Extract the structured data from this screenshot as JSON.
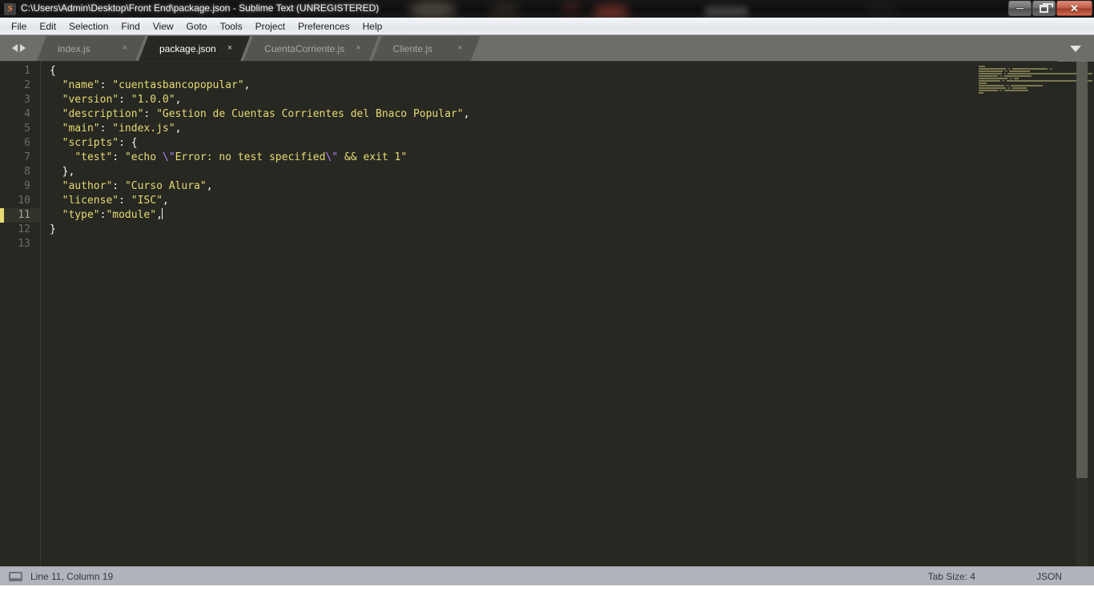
{
  "window": {
    "title": "C:\\Users\\Admin\\Desktop\\Front End\\package.json - Sublime Text (UNREGISTERED)",
    "logo_glyph": "S",
    "controls": {
      "minimize": "minimize-icon",
      "maximize": "restore-icon",
      "close": "✕"
    }
  },
  "menubar": {
    "items": [
      {
        "label": "File"
      },
      {
        "label": "Edit"
      },
      {
        "label": "Selection"
      },
      {
        "label": "Find"
      },
      {
        "label": "View"
      },
      {
        "label": "Goto"
      },
      {
        "label": "Tools"
      },
      {
        "label": "Project"
      },
      {
        "label": "Preferences"
      },
      {
        "label": "Help"
      }
    ]
  },
  "tabbar": {
    "nav_prev": "arrow-left-icon",
    "nav_next": "arrow-right-icon",
    "overflow": "chevron-down-icon",
    "close_glyph": "×",
    "tabs": [
      {
        "label": "index.js",
        "active": false
      },
      {
        "label": "package.json",
        "active": true
      },
      {
        "label": "CuentaCorriente.js",
        "active": false
      },
      {
        "label": "Cliente.js",
        "active": false
      }
    ]
  },
  "editor": {
    "active_line": 11,
    "gutter": [
      "1",
      "2",
      "3",
      "4",
      "5",
      "6",
      "7",
      "8",
      "9",
      "10",
      "11",
      "12",
      "13"
    ],
    "lines": [
      {
        "n": 1,
        "tokens": [
          {
            "t": "punc",
            "v": "{"
          }
        ]
      },
      {
        "n": 2,
        "tokens": [
          {
            "t": "punc",
            "v": "  "
          },
          {
            "t": "key",
            "v": "\"name\""
          },
          {
            "t": "punc",
            "v": ": "
          },
          {
            "t": "str",
            "v": "\"cuentasbancopopular\""
          },
          {
            "t": "punc",
            "v": ","
          }
        ]
      },
      {
        "n": 3,
        "tokens": [
          {
            "t": "punc",
            "v": "  "
          },
          {
            "t": "key",
            "v": "\"version\""
          },
          {
            "t": "punc",
            "v": ": "
          },
          {
            "t": "str",
            "v": "\"1.0.0\""
          },
          {
            "t": "punc",
            "v": ","
          }
        ]
      },
      {
        "n": 4,
        "tokens": [
          {
            "t": "punc",
            "v": "  "
          },
          {
            "t": "key",
            "v": "\"description\""
          },
          {
            "t": "punc",
            "v": ": "
          },
          {
            "t": "str",
            "v": "\"Gestion de Cuentas Corrientes del Bnaco Popular\""
          },
          {
            "t": "punc",
            "v": ","
          }
        ]
      },
      {
        "n": 5,
        "tokens": [
          {
            "t": "punc",
            "v": "  "
          },
          {
            "t": "key",
            "v": "\"main\""
          },
          {
            "t": "punc",
            "v": ": "
          },
          {
            "t": "str",
            "v": "\"index.js\""
          },
          {
            "t": "punc",
            "v": ","
          }
        ]
      },
      {
        "n": 6,
        "tokens": [
          {
            "t": "punc",
            "v": "  "
          },
          {
            "t": "key",
            "v": "\"scripts\""
          },
          {
            "t": "punc",
            "v": ": {"
          }
        ]
      },
      {
        "n": 7,
        "tokens": [
          {
            "t": "punc",
            "v": "    "
          },
          {
            "t": "key",
            "v": "\"test\""
          },
          {
            "t": "punc",
            "v": ": "
          },
          {
            "t": "str",
            "v": "\"echo "
          },
          {
            "t": "esc",
            "v": "\\\""
          },
          {
            "t": "str",
            "v": "Error: no test specified"
          },
          {
            "t": "esc",
            "v": "\\\""
          },
          {
            "t": "str",
            "v": " && exit 1\""
          }
        ]
      },
      {
        "n": 8,
        "tokens": [
          {
            "t": "punc",
            "v": "  },"
          }
        ]
      },
      {
        "n": 9,
        "tokens": [
          {
            "t": "punc",
            "v": "  "
          },
          {
            "t": "key",
            "v": "\"author\""
          },
          {
            "t": "punc",
            "v": ": "
          },
          {
            "t": "str",
            "v": "\"Curso Alura\""
          },
          {
            "t": "punc",
            "v": ","
          }
        ]
      },
      {
        "n": 10,
        "tokens": [
          {
            "t": "punc",
            "v": "  "
          },
          {
            "t": "key",
            "v": "\"license\""
          },
          {
            "t": "punc",
            "v": ": "
          },
          {
            "t": "str",
            "v": "\"ISC\""
          },
          {
            "t": "punc",
            "v": ","
          }
        ]
      },
      {
        "n": 11,
        "tokens": [
          {
            "t": "punc",
            "v": "  "
          },
          {
            "t": "key",
            "v": "\"type\""
          },
          {
            "t": "punc",
            "v": ":"
          },
          {
            "t": "str",
            "v": "\"module\""
          },
          {
            "t": "punc",
            "v": ","
          }
        ]
      },
      {
        "n": 12,
        "tokens": [
          {
            "t": "punc",
            "v": "}"
          }
        ]
      },
      {
        "n": 13,
        "tokens": []
      }
    ]
  },
  "minimap": {
    "rows": [
      [
        8
      ],
      [
        34,
        4,
        44,
        4
      ],
      [
        30,
        4,
        26
      ],
      [
        46,
        4,
        168
      ],
      [
        24,
        4,
        34
      ],
      [
        36,
        4,
        6
      ],
      [
        28,
        4,
        112
      ],
      [
        10
      ],
      [
        32,
        4,
        40
      ],
      [
        34,
        4,
        18
      ],
      [
        24,
        4,
        30
      ],
      [
        6
      ],
      []
    ]
  },
  "statusbar": {
    "console_icon": "console-icon",
    "position": "Line 11, Column 19",
    "tab_size": "Tab Size: 4",
    "syntax": "JSON"
  },
  "colors": {
    "editor_bg": "#272822",
    "string": "#e6db74",
    "escape": "#ae81ff",
    "plain": "#f8f8f2",
    "active_line_marker": "#e6db74",
    "tabbar_bg": "#6e6e68",
    "statusbar_bg": "#b0b5bd"
  }
}
